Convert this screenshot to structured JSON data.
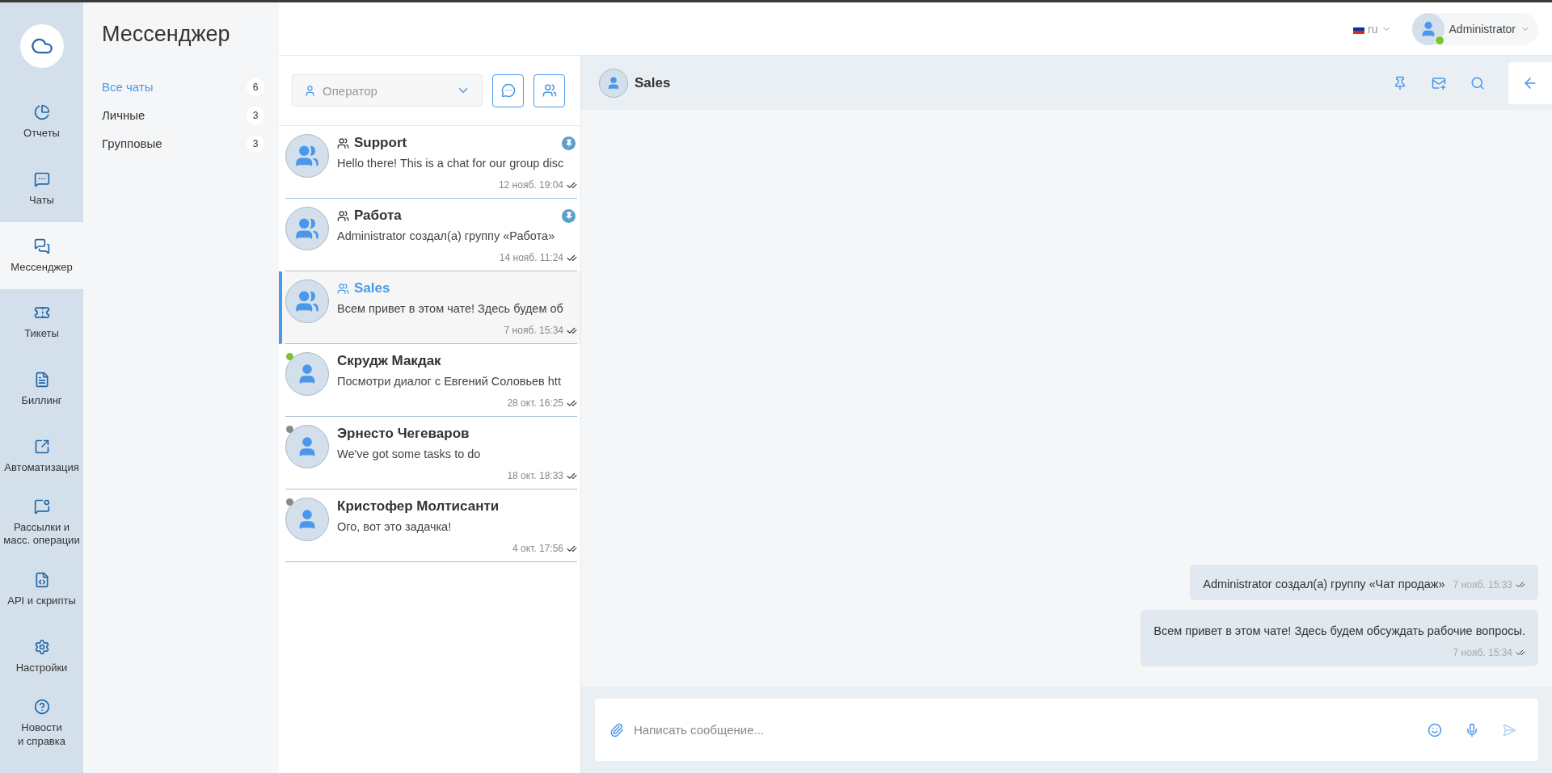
{
  "nav": {
    "items": [
      {
        "label": "Отчеты",
        "selected": false
      },
      {
        "label": "Чаты",
        "selected": false
      },
      {
        "label": "Мессенджер",
        "selected": true
      },
      {
        "label": "Тикеты",
        "selected": false
      },
      {
        "label": "Биллинг",
        "selected": false
      },
      {
        "label": "Автоматизация",
        "selected": false
      },
      {
        "label": "Рассылки и\nмасс. операции",
        "selected": false
      },
      {
        "label": "API и скрипты",
        "selected": false
      },
      {
        "label": "Настройки",
        "selected": false
      },
      {
        "label": "Новости\nи справка",
        "selected": false
      }
    ]
  },
  "section": {
    "title": "Мессенджер",
    "filters": [
      {
        "label": "Все чаты",
        "count": "6",
        "selected": true
      },
      {
        "label": "Личные",
        "count": "3",
        "selected": false
      },
      {
        "label": "Групповые",
        "count": "3",
        "selected": false
      }
    ]
  },
  "header": {
    "language": "ru",
    "user": {
      "name": "Administrator",
      "online": true
    }
  },
  "chat_list": {
    "operator_select": {
      "placeholder": "Оператор"
    },
    "chats": [
      {
        "kind": "group",
        "name": "Support",
        "preview": "Hello there! This is a chat for our group disc",
        "time": "12 нояб. 19:04",
        "pinned": true,
        "selected": false
      },
      {
        "kind": "group",
        "name": "Работа",
        "preview": "Administrator создал(а) группу «Работа»",
        "time": "14 нояб. 11:24",
        "pinned": true,
        "selected": false
      },
      {
        "kind": "group",
        "name": "Sales",
        "preview": "Всем привет в этом чате! Здесь будем об",
        "time": "7 нояб. 15:34",
        "pinned": false,
        "selected": true
      },
      {
        "kind": "personal",
        "name": "Скрудж Макдак",
        "preview": "Посмотри диалог с Евгений Соловьев htt",
        "time": "28 окт. 16:25",
        "pinned": false,
        "selected": false,
        "color": "#7cc232"
      },
      {
        "kind": "personal",
        "name": "Эрнесто Чегеваров",
        "preview": "We've got some tasks to do",
        "time": "18 окт. 18:33",
        "pinned": false,
        "selected": false,
        "color": "#8a8a8a"
      },
      {
        "kind": "personal",
        "name": "Кристофер Молтисанти",
        "preview": "Ого, вот это задачка!",
        "time": "4 окт. 17:56",
        "pinned": false,
        "selected": false,
        "color": "#8a8a8a"
      }
    ]
  },
  "conversation": {
    "title": "Sales",
    "messages": [
      {
        "kind": "inline",
        "text": "Administrator создал(а) группу «Чат продаж»",
        "time": "7 нояб. 15:33"
      },
      {
        "kind": "block",
        "text": "Всем привет в этом чате! Здесь будем обсуждать рабочие вопросы.",
        "time": "7 нояб. 15:34"
      }
    ],
    "composer": {
      "placeholder": "Написать сообщение..."
    }
  }
}
